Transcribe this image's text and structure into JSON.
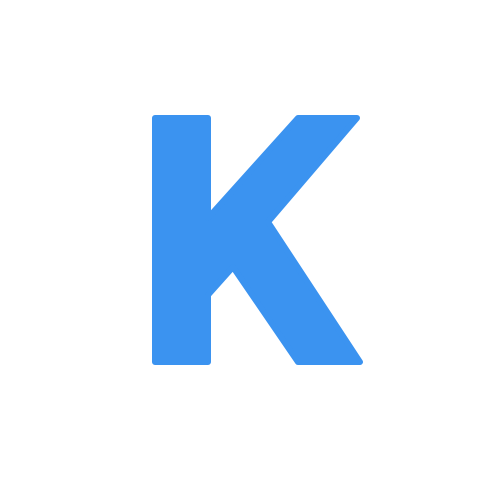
{
  "logo": {
    "letter": "K",
    "icon": "letter-k-logo",
    "color": "#3b93f0",
    "background": "#ffffff"
  }
}
